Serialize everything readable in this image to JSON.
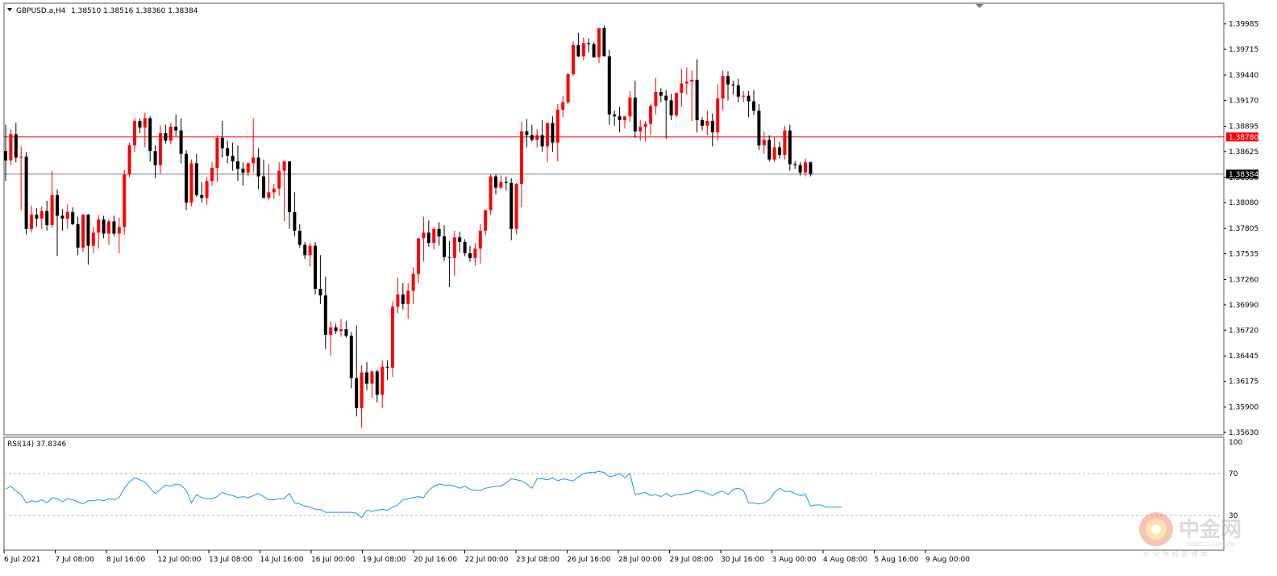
{
  "header": {
    "symbol": "GBPUSD.a,H4",
    "ohlc": "1.38510 1.38516 1.38360 1.38384"
  },
  "rsi_header": "RSI(14) 37.8346",
  "price_labels": {
    "h_line": "1.38780",
    "current": "1.38384"
  },
  "watermark": {
    "cn": "中金网",
    "url": "CNGOLD.COM.CN",
    "tag": "中 文 财 经 新 媒 体"
  },
  "colors": {
    "bull": "#ff0000",
    "bear": "#000000",
    "doji": "#00c000",
    "h_line": "#ff0000",
    "current_line": "#708090",
    "rsi": "#1e90ff"
  },
  "chart_data": [
    {
      "type": "candlestick",
      "symbol": "GBPUSD.a",
      "timeframe": "H4",
      "ylim": [
        1.3563,
        1.4012
      ],
      "y_ticks": [
        "1.39985",
        "1.39715",
        "1.39440",
        "1.39170",
        "1.38895",
        "1.38625",
        "1.38350",
        "1.38080",
        "1.37805",
        "1.37535",
        "1.37260",
        "1.36990",
        "1.36720",
        "1.36445",
        "1.36175",
        "1.35900",
        "1.35630"
      ],
      "x_ticks": [
        "6 Jul 2021",
        "7 Jul 08:00",
        "8 Jul 16:00",
        "12 Jul 00:00",
        "13 Jul 08:00",
        "14 Jul 16:00",
        "16 Jul 00:00",
        "19 Jul 08:00",
        "20 Jul 16:00",
        "22 Jul 00:00",
        "23 Jul 08:00",
        "26 Jul 16:00",
        "28 Jul 00:00",
        "29 Jul 08:00",
        "30 Jul 16:00",
        "3 Aug 00:00",
        "4 Aug 08:00",
        "5 Aug 16:00",
        "9 Aug 00:00"
      ],
      "horizontal_line": 1.3878,
      "current_price": 1.38384,
      "ohlc": [
        [
          1.3863,
          1.3891,
          1.3831,
          1.3853
        ],
        [
          1.3853,
          1.3886,
          1.3848,
          1.3881
        ],
        [
          1.3881,
          1.3893,
          1.3851,
          1.3856
        ],
        [
          1.3856,
          1.3868,
          1.38,
          1.3857
        ],
        [
          1.3857,
          1.3862,
          1.3774,
          1.378
        ],
        [
          1.378,
          1.3805,
          1.3776,
          1.3795
        ],
        [
          1.3795,
          1.3802,
          1.3782,
          1.3791
        ],
        [
          1.3791,
          1.3804,
          1.378,
          1.3799
        ],
        [
          1.3799,
          1.381,
          1.3778,
          1.3784
        ],
        [
          1.3784,
          1.3842,
          1.3781,
          1.3816
        ],
        [
          1.3816,
          1.3822,
          1.3751,
          1.3794
        ],
        [
          1.3794,
          1.3801,
          1.3778,
          1.3791
        ],
        [
          1.3791,
          1.3806,
          1.378,
          1.3798
        ],
        [
          1.3798,
          1.3803,
          1.3784,
          1.3785
        ],
        [
          1.3785,
          1.3793,
          1.3752,
          1.376
        ],
        [
          1.376,
          1.3796,
          1.3755,
          1.3795
        ],
        [
          1.3795,
          1.3796,
          1.3742,
          1.3762
        ],
        [
          1.3762,
          1.3782,
          1.3754,
          1.3776
        ],
        [
          1.3776,
          1.3795,
          1.3759,
          1.379
        ],
        [
          1.379,
          1.3794,
          1.377,
          1.3775
        ],
        [
          1.3775,
          1.379,
          1.3763,
          1.3788
        ],
        [
          1.3788,
          1.3794,
          1.3772,
          1.3775
        ],
        [
          1.3775,
          1.3792,
          1.3754,
          1.3782
        ],
        [
          1.3782,
          1.3843,
          1.3774,
          1.3838
        ],
        [
          1.3838,
          1.3872,
          1.3835,
          1.3869
        ],
        [
          1.3869,
          1.3898,
          1.3862,
          1.3895
        ],
        [
          1.3895,
          1.3898,
          1.3882,
          1.3888
        ],
        [
          1.3888,
          1.3904,
          1.3867,
          1.3898
        ],
        [
          1.3898,
          1.39,
          1.3852,
          1.3863
        ],
        [
          1.3863,
          1.3869,
          1.3834,
          1.3848
        ],
        [
          1.3848,
          1.389,
          1.3839,
          1.3882
        ],
        [
          1.3882,
          1.3891,
          1.3871,
          1.3874
        ],
        [
          1.3874,
          1.3893,
          1.387,
          1.3889
        ],
        [
          1.3889,
          1.3902,
          1.3879,
          1.3885
        ],
        [
          1.3885,
          1.3898,
          1.385,
          1.386
        ],
        [
          1.386,
          1.3864,
          1.38,
          1.3808
        ],
        [
          1.3808,
          1.3854,
          1.3804,
          1.385
        ],
        [
          1.385,
          1.386,
          1.3814,
          1.3816
        ],
        [
          1.3816,
          1.383,
          1.3808,
          1.3813
        ],
        [
          1.3813,
          1.3835,
          1.3806,
          1.3831
        ],
        [
          1.3831,
          1.3851,
          1.3826,
          1.3845
        ],
        [
          1.3845,
          1.388,
          1.383,
          1.3877
        ],
        [
          1.3877,
          1.3895,
          1.3856,
          1.3866
        ],
        [
          1.3866,
          1.3874,
          1.385,
          1.3858
        ],
        [
          1.3858,
          1.3872,
          1.3842,
          1.3852
        ],
        [
          1.3852,
          1.3869,
          1.3831,
          1.3844
        ],
        [
          1.3844,
          1.3851,
          1.3826,
          1.384
        ],
        [
          1.384,
          1.3851,
          1.3836,
          1.385
        ],
        [
          1.385,
          1.3898,
          1.384,
          1.3856
        ],
        [
          1.3856,
          1.3866,
          1.3822,
          1.3836
        ],
        [
          1.3836,
          1.3854,
          1.3829,
          1.3813
        ],
        [
          1.3813,
          1.3849,
          1.3811,
          1.3819
        ],
        [
          1.3819,
          1.3828,
          1.3812,
          1.3823
        ],
        [
          1.3823,
          1.3851,
          1.3815,
          1.3842
        ],
        [
          1.3842,
          1.3852,
          1.3788,
          1.3852
        ],
        [
          1.3852,
          1.3852,
          1.378,
          1.3798
        ],
        [
          1.3798,
          1.3819,
          1.3772,
          1.3778
        ],
        [
          1.3778,
          1.3785,
          1.376,
          1.3763
        ],
        [
          1.3763,
          1.3766,
          1.3748,
          1.3752
        ],
        [
          1.3752,
          1.3765,
          1.374,
          1.3762
        ],
        [
          1.3762,
          1.3766,
          1.371,
          1.3716
        ],
        [
          1.3716,
          1.3752,
          1.37,
          1.3709
        ],
        [
          1.3709,
          1.3729,
          1.3652,
          1.3667
        ],
        [
          1.3667,
          1.3681,
          1.3645,
          1.3675
        ],
        [
          1.3675,
          1.3679,
          1.3668,
          1.3671
        ],
        [
          1.3671,
          1.3684,
          1.3665,
          1.3673
        ],
        [
          1.3673,
          1.3682,
          1.3664,
          1.3666
        ],
        [
          1.3666,
          1.367,
          1.361,
          1.3621
        ],
        [
          1.3621,
          1.3677,
          1.358,
          1.3589
        ],
        [
          1.3589,
          1.3635,
          1.3568,
          1.3627
        ],
        [
          1.3627,
          1.3638,
          1.3608,
          1.3615
        ],
        [
          1.3615,
          1.3629,
          1.36,
          1.3628
        ],
        [
          1.3628,
          1.363,
          1.3595,
          1.3603
        ],
        [
          1.3603,
          1.364,
          1.3589,
          1.3633
        ],
        [
          1.3633,
          1.364,
          1.3619,
          1.3632
        ],
        [
          1.3632,
          1.3703,
          1.3622,
          1.3697
        ],
        [
          1.3697,
          1.3728,
          1.369,
          1.371
        ],
        [
          1.371,
          1.3722,
          1.3694,
          1.37
        ],
        [
          1.37,
          1.3722,
          1.3684,
          1.3714
        ],
        [
          1.3714,
          1.3739,
          1.37,
          1.3732
        ],
        [
          1.3732,
          1.3767,
          1.3722,
          1.377
        ],
        [
          1.377,
          1.3793,
          1.3745,
          1.3776
        ],
        [
          1.3776,
          1.3789,
          1.3761,
          1.3765
        ],
        [
          1.3765,
          1.3782,
          1.3758,
          1.378
        ],
        [
          1.378,
          1.3787,
          1.3762,
          1.3772
        ],
        [
          1.3772,
          1.3784,
          1.3746,
          1.375
        ],
        [
          1.375,
          1.3767,
          1.3718,
          1.3749
        ],
        [
          1.3749,
          1.3778,
          1.373,
          1.3771
        ],
        [
          1.3771,
          1.3777,
          1.3755,
          1.3766
        ],
        [
          1.3766,
          1.3769,
          1.3751,
          1.3754
        ],
        [
          1.3754,
          1.3762,
          1.3745,
          1.3749
        ],
        [
          1.3749,
          1.3765,
          1.3741,
          1.3759
        ],
        [
          1.3759,
          1.3785,
          1.3743,
          1.3778
        ],
        [
          1.3778,
          1.3797,
          1.3773,
          1.38
        ],
        [
          1.38,
          1.3838,
          1.3795,
          1.3836
        ],
        [
          1.3836,
          1.3838,
          1.3817,
          1.3824
        ],
        [
          1.3824,
          1.3837,
          1.3822,
          1.383
        ],
        [
          1.383,
          1.3836,
          1.3821,
          1.3829
        ],
        [
          1.3829,
          1.3834,
          1.3768,
          1.378
        ],
        [
          1.378,
          1.3829,
          1.3774,
          1.3828
        ],
        [
          1.3828,
          1.3894,
          1.3803,
          1.3884
        ],
        [
          1.3884,
          1.3897,
          1.3867,
          1.388
        ],
        [
          1.388,
          1.3891,
          1.3873,
          1.3875
        ],
        [
          1.3875,
          1.3886,
          1.3867,
          1.388
        ],
        [
          1.388,
          1.3896,
          1.3862,
          1.3868
        ],
        [
          1.3868,
          1.3887,
          1.3851,
          1.3893
        ],
        [
          1.3893,
          1.39,
          1.3862,
          1.3872
        ],
        [
          1.3872,
          1.3913,
          1.3852,
          1.3907
        ],
        [
          1.3907,
          1.3922,
          1.3899,
          1.3915
        ],
        [
          1.3915,
          1.3946,
          1.3913,
          1.3945
        ],
        [
          1.3945,
          1.398,
          1.3943,
          1.3976
        ],
        [
          1.3976,
          1.3989,
          1.3963,
          1.3964
        ],
        [
          1.3964,
          1.3984,
          1.396,
          1.3978
        ],
        [
          1.3978,
          1.3983,
          1.3968,
          1.3977
        ],
        [
          1.3977,
          1.3979,
          1.3962,
          1.3963
        ],
        [
          1.3963,
          1.399,
          1.3957,
          1.3994
        ],
        [
          1.3994,
          1.3997,
          1.3968,
          1.3964
        ],
        [
          1.3964,
          1.3971,
          1.3891,
          1.3902
        ],
        [
          1.3902,
          1.3906,
          1.389,
          1.39
        ],
        [
          1.39,
          1.391,
          1.3883,
          1.3896
        ],
        [
          1.3896,
          1.39,
          1.3887,
          1.39
        ],
        [
          1.39,
          1.3927,
          1.3894,
          1.392
        ],
        [
          1.392,
          1.3938,
          1.3877,
          1.3884
        ],
        [
          1.3884,
          1.3896,
          1.3874,
          1.3889
        ],
        [
          1.3889,
          1.3895,
          1.3873,
          1.3892
        ],
        [
          1.3892,
          1.3913,
          1.388,
          1.3911
        ],
        [
          1.3911,
          1.3941,
          1.3902,
          1.3926
        ],
        [
          1.3926,
          1.393,
          1.3915,
          1.3922
        ],
        [
          1.3922,
          1.3928,
          1.3876,
          1.3917
        ],
        [
          1.3917,
          1.3924,
          1.3896,
          1.3901
        ],
        [
          1.3901,
          1.392,
          1.3899,
          1.3925
        ],
        [
          1.3925,
          1.395,
          1.391,
          1.3935
        ],
        [
          1.3935,
          1.3952,
          1.3923,
          1.3937
        ],
        [
          1.3937,
          1.3949,
          1.3895,
          1.3939
        ],
        [
          1.3939,
          1.3961,
          1.3883,
          1.3896
        ],
        [
          1.3896,
          1.3899,
          1.3885,
          1.389
        ],
        [
          1.389,
          1.3906,
          1.388,
          1.3895
        ],
        [
          1.3895,
          1.3903,
          1.3868,
          1.3883
        ],
        [
          1.3883,
          1.3934,
          1.3874,
          1.3919
        ],
        [
          1.3919,
          1.3949,
          1.3907,
          1.3943
        ],
        [
          1.3943,
          1.3948,
          1.3917,
          1.3934
        ],
        [
          1.3934,
          1.3938,
          1.3923,
          1.3933
        ],
        [
          1.3933,
          1.394,
          1.3915,
          1.3921
        ],
        [
          1.3921,
          1.3927,
          1.3915,
          1.3922
        ],
        [
          1.3922,
          1.3927,
          1.3899,
          1.3916
        ],
        [
          1.3916,
          1.3928,
          1.3901,
          1.3906
        ],
        [
          1.3906,
          1.3913,
          1.3864,
          1.3869
        ],
        [
          1.3869,
          1.3884,
          1.386,
          1.3875
        ],
        [
          1.3875,
          1.388,
          1.3852,
          1.3854
        ],
        [
          1.3854,
          1.3878,
          1.3851,
          1.3867
        ],
        [
          1.3867,
          1.3873,
          1.3855,
          1.3859
        ],
        [
          1.3859,
          1.389,
          1.3854,
          1.3885
        ],
        [
          1.3885,
          1.3891,
          1.3842,
          1.3849
        ],
        [
          1.3849,
          1.3852,
          1.3844,
          1.3848
        ],
        [
          1.3848,
          1.3851,
          1.3837,
          1.384
        ],
        [
          1.384,
          1.3855,
          1.3836,
          1.3851
        ],
        [
          1.3851,
          1.38516,
          1.3836,
          1.38384
        ]
      ]
    },
    {
      "type": "line",
      "name": "RSI(14)",
      "ylim": [
        0,
        100
      ],
      "y_ticks": [
        "100",
        "70",
        "30"
      ],
      "levels": [
        70,
        30
      ],
      "last_value": 37.8346,
      "values": [
        55,
        58,
        53,
        50,
        42,
        44,
        43,
        45,
        42,
        47,
        46,
        43,
        46,
        45,
        43,
        41,
        44,
        44,
        45,
        44,
        46,
        45,
        47,
        56,
        62,
        66,
        64,
        62,
        56,
        51,
        55,
        59,
        58,
        60,
        59,
        54,
        42,
        50,
        47,
        46,
        46,
        48,
        52,
        50,
        49,
        47,
        48,
        47,
        49,
        51,
        48,
        45,
        45,
        46,
        46,
        51,
        42,
        41,
        39,
        38,
        36,
        36,
        33,
        33,
        33,
        33,
        33,
        33,
        32,
        28,
        35,
        34,
        35,
        36,
        35,
        38,
        40,
        45,
        46,
        47,
        48,
        47,
        54,
        58,
        60,
        59,
        59,
        58,
        56,
        58,
        55,
        54,
        54,
        56,
        57,
        58,
        58,
        61,
        65,
        64,
        63,
        60,
        56,
        65,
        65,
        64,
        66,
        63,
        65,
        64,
        63,
        67,
        70,
        71,
        71,
        72,
        71,
        67,
        68,
        70,
        66,
        70,
        50,
        51,
        52,
        49,
        50,
        48,
        51,
        48,
        50,
        50,
        51,
        52,
        54,
        53,
        51,
        49,
        52,
        53,
        50,
        55,
        56,
        54,
        42,
        42,
        41,
        42,
        45,
        52,
        56,
        53,
        53,
        51,
        49,
        50,
        39,
        40,
        40,
        38,
        38,
        38,
        38
      ]
    }
  ]
}
